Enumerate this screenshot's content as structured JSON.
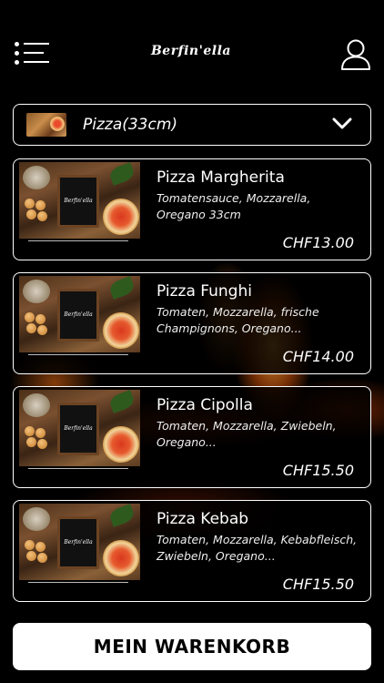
{
  "header": {
    "logo_text": "Berfin'ella",
    "menu_icon": "menu-icon",
    "user_icon": "user-icon"
  },
  "category": {
    "selected": "Pizza(33cm)",
    "icon": "chevron-down-icon"
  },
  "products": [
    {
      "name": "Pizza Margherita",
      "description": "Tomatensauce, Mozzarella, Oregano 33cm",
      "price": "CHF13.00",
      "image_text": "Berfin'ella"
    },
    {
      "name": "Pizza Funghi",
      "description": "Tomaten, Mozzarella, frische Champignons, Oregano...",
      "price": "CHF14.00",
      "image_text": "Berfin'ella"
    },
    {
      "name": "Pizza Cipolla",
      "description": "Tomaten, Mozzarella, Zwiebeln, Oregano...",
      "price": "CHF15.50",
      "image_text": "Berfin'ella"
    },
    {
      "name": "Pizza Kebab",
      "description": "Tomaten, Mozzarella, Kebabfleisch, Zwiebeln, Oregano...",
      "price": "CHF15.50",
      "image_text": "Berfin'ella"
    }
  ],
  "cart": {
    "label": "MEIN WARENKORB"
  },
  "colors": {
    "background": "#000000",
    "foreground": "#ffffff",
    "fire": "#e65a14"
  }
}
